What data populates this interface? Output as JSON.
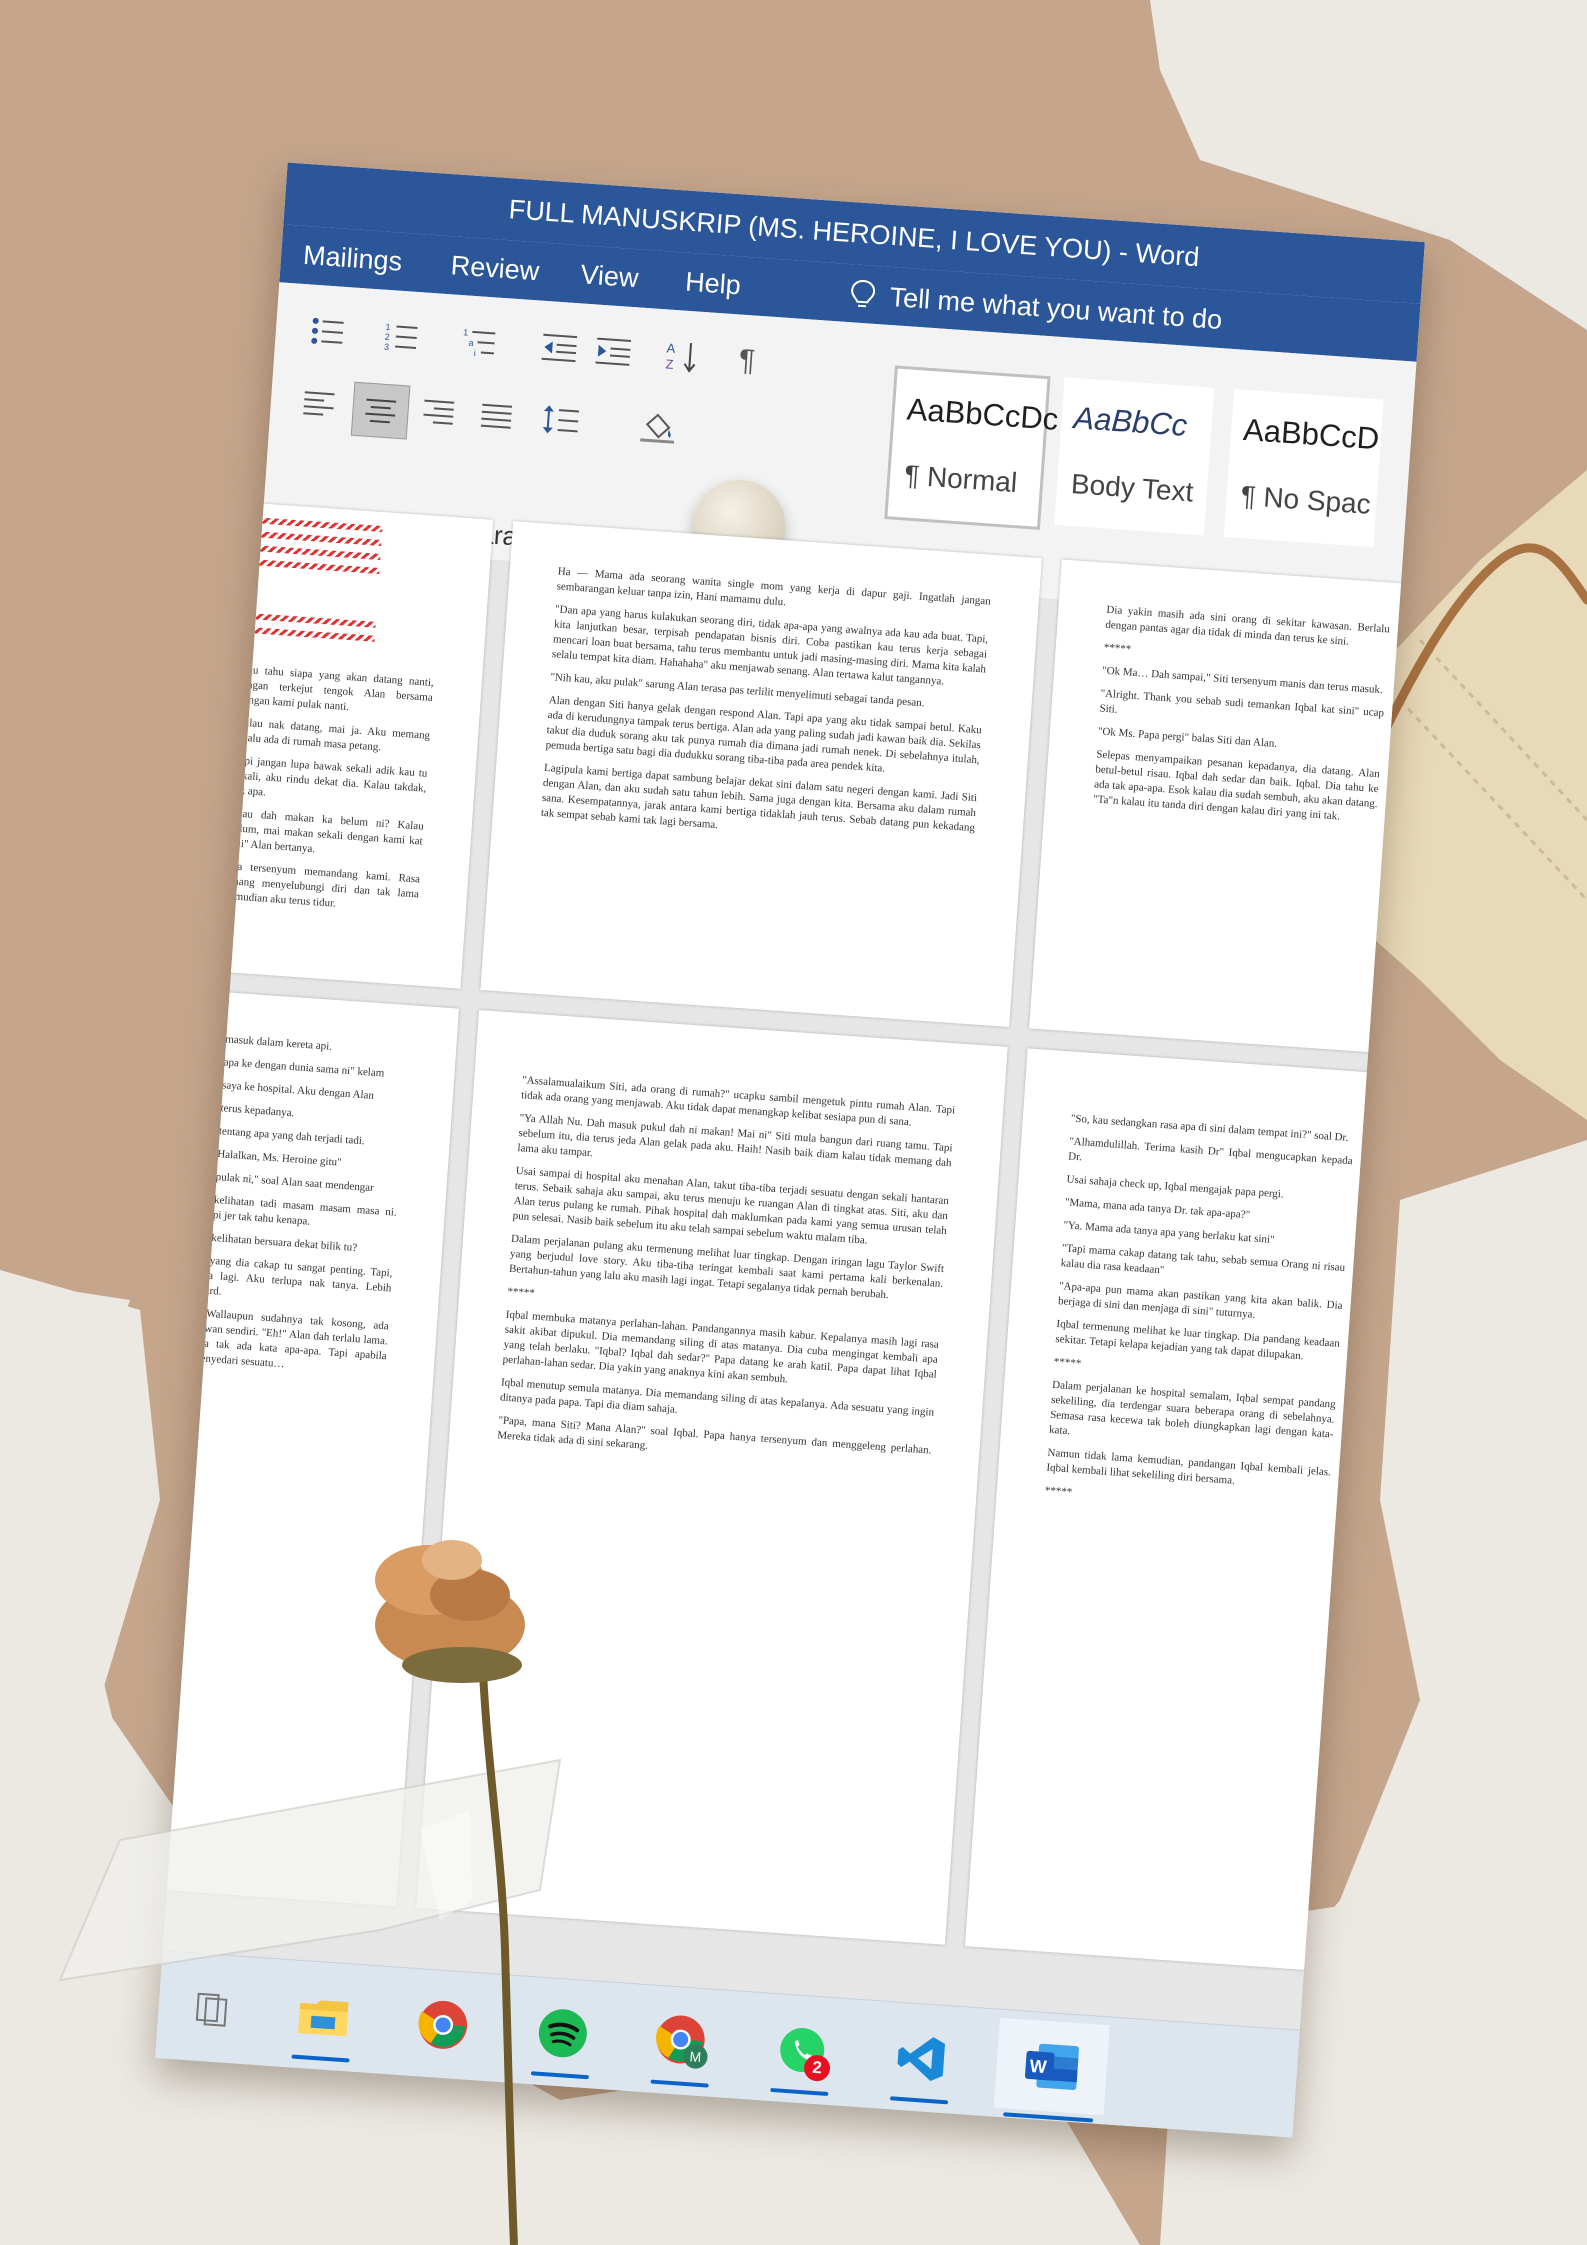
{
  "colors": {
    "word_blue": "#2b579a",
    "kraft_paper": "#c5a68d",
    "torn_paper_white": "#ece9e3",
    "cream_tag": "#e8d9b8",
    "ribbon_gray": "#f3f3f3"
  },
  "window": {
    "title": "FULL MANUSKRIP (MS. HEROINE, I LOVE YOU)  -  Word"
  },
  "tabs": [
    "Mailings",
    "Review",
    "View",
    "Help"
  ],
  "tell_me": {
    "icon": "lightbulb-icon",
    "label": "Tell me what you want to do"
  },
  "ribbon": {
    "paragraph_group_label": "Paragraph",
    "paragraph_buttons": [
      {
        "name": "bullets-button",
        "icon": "bullets-icon"
      },
      {
        "name": "numbering-button",
        "icon": "numbering-icon"
      },
      {
        "name": "multilevel-list-button",
        "icon": "multilevel-list-icon"
      },
      {
        "name": "decrease-indent-button",
        "icon": "decrease-indent-icon"
      },
      {
        "name": "increase-indent-button",
        "icon": "increase-indent-icon"
      },
      {
        "name": "sort-button",
        "icon": "sort-az-icon"
      },
      {
        "name": "show-marks-button",
        "icon": "pilcrow-icon"
      },
      {
        "name": "align-left-button",
        "icon": "align-left-icon"
      },
      {
        "name": "align-center-button",
        "icon": "align-center-icon",
        "selected": true
      },
      {
        "name": "align-right-button",
        "icon": "align-right-icon"
      },
      {
        "name": "justify-button",
        "icon": "justify-icon"
      },
      {
        "name": "line-spacing-button",
        "icon": "line-spacing-icon"
      },
      {
        "name": "shading-button",
        "icon": "paint-bucket-icon"
      }
    ],
    "styles": [
      {
        "preview": "AaBbCcDc",
        "name": "¶ Normal",
        "selected": true
      },
      {
        "preview": "AaBbCc",
        "name": "Body Text",
        "selected": false
      },
      {
        "preview": "AaBbCcD",
        "name": "¶ No Spac",
        "selected": false
      }
    ]
  },
  "pages": [
    {
      "id": "top-center",
      "paragraphs": [
        "Ha — Mama ada seorang wanita single mom yang kerja di dapur gaji. Ingatlah jangan sembarangan keluar tanpa izin, Hani mamamu dulu.",
        "\"Dan apa yang harus kulakukan seorang diri, tidak apa-apa yang awalnya ada kau ada buat. Tapi, kita lanjutkan besar, terpisah pendapatan bisnis diri. Coba pastikan kau terus kerja sebagai mencari loan buat bersama, tahu terus membantu untuk jadi masing-masing diri. Mama kita kalah selalu tempat kita diam. Hahahaha\" aku menjawab senang. Alan tertawa kalut tangannya.",
        "\"Nih kau, aku pulak\" sarung Alan terasa pas terlilit menyelimuti sebagai tanda pesan.",
        "Alan dengan Siti hanya gelak dengan respond Alan. Tapi apa yang aku tidak sampai betul. Kaku ada di kerudungnya tampak terus bertiga. Alan ada yang paling sudah jadi kawan baik dia. Sekilas takut dia duduk sorang aku tak punya rumah dia dimana jadi rumah nenek. Di sebelahnya itulah, pemuda bertiga satu bagi dia dudukku sorang tiba-tiba pada area pendek kita.",
        "Lagipula kami bertiga dapat sambung belajar dekat sini dalam satu negeri dengan kami. Jadi Siti dengan Alan, dan aku sudah satu tahun lebih. Sama juga dengan kita. Bersama aku dalam rumah sana. Kesempatannya, jarak antara kami bertiga tidaklah jauh terus. Sebab datang pun kekadang tak sempat sebab kami tak lagi bersama."
      ]
    },
    {
      "id": "bottom-center",
      "paragraphs": [
        "\"Assalamualaikum Siti, ada orang di rumah?\" ucapku sambil mengetuk pintu rumah Alan. Tapi tidak ada orang yang menjawab. Aku tidak dapat menangkap kelibat sesiapa pun di sana.",
        "\"Ya Allah Nu. Dah masuk pukul dah ni makan! Mai ni\" Siti mula bangun dari ruang tamu. Tapi sebelum itu, dia terus jeda Alan gelak pada aku. Haih! Nasib baik diam kalau tidak memang dah lama aku tampar.",
        "Usai sampai di hospital aku menahan Alan, takut tiba-tiba terjadi sesuatu dengan sekali hantaran terus. Sebaik sahaja aku sampai, aku terus menuju ke ruangan Alan di tingkat atas. Siti, aku dan Alan terus pulang ke rumah. Pihak hospital dah maklumkan pada kami yang semua urusan telah pun selesai. Nasib baik sebelum itu aku telah sampai sebelum waktu malam tiba.",
        "Dalam perjalanan pulang aku termenung melihat luar tingkap. Dengan iringan lagu Taylor Swift yang berjudul love story. Aku tiba-tiba teringat kembali saat kami pertama kali berkenalan. Bertahun-tahun yang lalu aku masih lagi ingat. Tetapi segalanya tidak pernah berubah.",
        "*****",
        "Iqbal membuka matanya perlahan-lahan. Pandangannya masih kabur. Kepalanya masih lagi rasa sakit akibat dipukul. Dia memandang siling di atas matanya. Dia cuba mengingat kembali apa yang telah berlaku. \"Iqbal? Iqbal dah sedar?\" Papa datang ke arah katil. Papa dapat lihat Iqbal perlahan-lahan sedar. Dia yakin yang anaknya kini akan sembuh.",
        "Iqbal menutup semula matanya. Dia memandang siling di atas kepalanya. Ada sesuatu yang ingin ditanya pada papa. Tapi dia diam sahaja.",
        "\"Papa, mana Siti? Mana Alan?\" soal Iqbal. Papa hanya tersenyum dan menggeleng perlahan. Mereka tidak ada di sini sekarang."
      ]
    },
    {
      "id": "top-left",
      "paragraphs": [
        "Kau tahu siapa yang akan datang nanti, jangan terkejut tengok Alan bersama dengan kami pulak nanti.",
        "Kalau nak datang, mai ja. Aku memang selalu ada di rumah masa petang.",
        "Tapi jangan lupa bawak sekali adik kau tu sekali, aku rindu dekat dia. Kalau takdak, tak apa.",
        "\"Kau dah makan ka belum ni? Kalau belum, mai makan sekali dengan kami kat sini\" Alan bertanya.",
        "Dia tersenyum memandang kami. Rasa tenang menyelubungi diri dan tak lama kemudian aku terus tidur."
      ]
    },
    {
      "id": "bottom-left",
      "paragraphs": [
        "…masuk dalam kereta api.",
        "…apa ke dengan dunia sama ni\" kelam",
        "…saya ke hospital. Aku dengan Alan",
        "…terus kepadanya.",
        "…tentang apa yang dah terjadi tadi.",
        "…Halalkan, Ms. Heroine gitu\"",
        "…pulak ni,\" soal Alan saat mendengar",
        "…kelihatan tadi masam masam masa ni. Tapi jer tak tahu kenapa.",
        "…kelihatan bersuara dekat bilik tu?",
        "…yang dia cakap tu sangat penting. Tapi, ada lagi. Aku terlupa nak tanya. Lebih Gard.",
        "…Wallaupun sudahnya tak kosong, ada kawan sendiri. \"Eh!\" Alan dah terlalu lama. Dia tak ada kata apa-apa. Tapi apabila menyedari sesuatu…"
      ]
    },
    {
      "id": "top-right",
      "paragraphs": [
        "Dia yakin masih ada sini orang di sekitar kawasan. Berlalu dengan pantas agar dia tidak di minda dan terus ke sini.",
        "*****",
        "\"Ok Ma… Dah sampai,\" Siti tersenyum manis dan terus masuk.",
        "\"Alright. Thank you sebab sudi temankan Iqbal kat sini\" ucap Siti.",
        "\"Ok Ms. Papa pergi\" balas Siti dan Alan.",
        "Selepas menyampaikan pesanan kepadanya, dia datang. Alan betul-betul risau. Iqbal dah sedar dan baik. Iqbal. Dia tahu ke ada tak apa-apa. Esok kalau dia sudah sembuh, aku akan datang. \"Ta\"n kalau itu tanda diri dengan kalau diri yang ini tak."
      ]
    },
    {
      "id": "bottom-right",
      "paragraphs": [
        "\"So, kau sedangkan rasa apa di sini dalam tempat ini?\" soal Dr.",
        "\"Alhamdulillah. Terima kasih Dr\" Iqbal mengucapkan kepada Dr.",
        "Usai sahaja check up, Iqbal mengajak papa pergi.",
        "\"Mama, mana ada tanya Dr. tak apa-apa?\"",
        "\"Ya. Mama ada tanya apa yang berlaku kat sini\"",
        "\"Tapi mama cakap datang tak tahu, sebab semua Orang ni risau kalau dia rasa keadaan\"",
        "\"Apa-apa pun mama akan pastikan yang kita akan balik. Dia berjaga di sini dan menjaga di sini\" tuturnya.",
        "Iqbal termenung melihat ke luar tingkap. Dia pandang keadaan sekitar. Tetapi kelapa kejadian yang tak dapat dilupakan.",
        "*****",
        "Dalam perjalanan ke hospital semalam, Iqbal sempat pandang sekeliling, dia terdengar suara beberapa orang di sebelahnya. Semasa rasa kecewa tak boleh diungkapkan lagi dengan kata-kata.",
        "Namun tidak lama kemudian, pandangan Iqbal kembali jelas. Iqbal kembali lihat sekeliling diri bersama.",
        "*****"
      ]
    }
  ],
  "taskbar": {
    "items": [
      {
        "name": "taskview-icon",
        "underline": false
      },
      {
        "name": "file-explorer-icon",
        "underline": true
      },
      {
        "name": "chrome-icon",
        "underline": false
      },
      {
        "name": "spotify-icon",
        "underline": true
      },
      {
        "name": "chrome-profile-icon",
        "underline": true
      },
      {
        "name": "whatsapp-icon",
        "underline": true,
        "badge": "2"
      },
      {
        "name": "vscode-icon",
        "underline": true
      },
      {
        "name": "word-icon",
        "underline": true,
        "active": true
      }
    ]
  }
}
